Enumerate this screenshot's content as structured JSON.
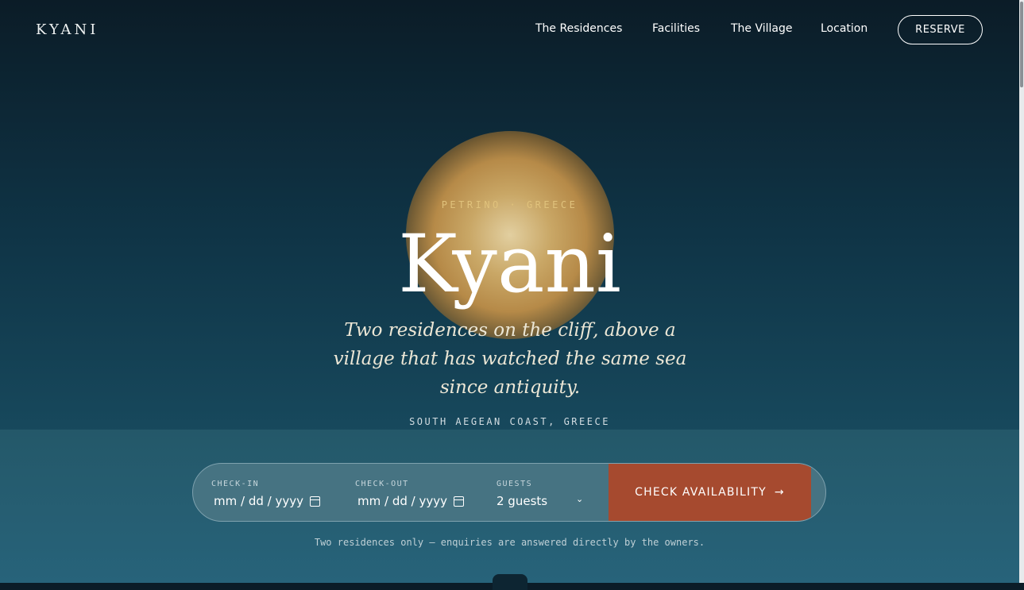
{
  "brand": "KYANI",
  "nav": {
    "items": [
      "The Residences",
      "Facilities",
      "The Village",
      "Location"
    ],
    "reserve_label": "RESERVE"
  },
  "hero": {
    "eyebrow": "PETRINO · GREECE",
    "title": "Kyani",
    "subtitle": "Two residences on the cliff, above a village that has watched the same sea since antiquity.",
    "region": "SOUTH AEGEAN COAST, GREECE"
  },
  "booking": {
    "checkin_label": "CHECK-IN",
    "checkin_placeholder": "mm / dd / yyyy",
    "checkout_label": "CHECK-OUT",
    "checkout_placeholder": "mm / dd / yyyy",
    "guests_label": "GUESTS",
    "guests_value": "2 guests",
    "cta_label": "CHECK AVAILABILITY",
    "cta_arrow": "→",
    "note": "Two residences only — enquiries are answered directly by the owners."
  },
  "icons": {
    "calendar": "calendar-icon",
    "chevron": "chevron-down-icon",
    "arrow": "arrow-right-icon"
  },
  "colors": {
    "accent": "#a64a2f",
    "gold": "#e0c27c",
    "background_top": "#0b1c27",
    "background_bottom": "#2a6a80"
  }
}
